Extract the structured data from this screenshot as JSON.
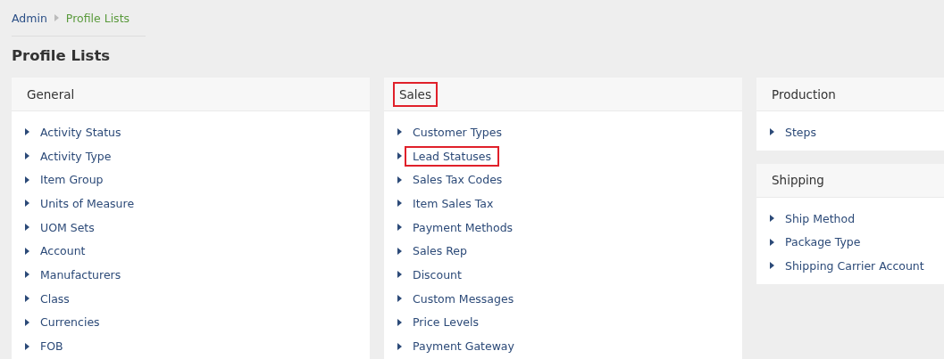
{
  "breadcrumb": [
    {
      "label": "Admin",
      "current": false
    },
    {
      "label": "Profile Lists",
      "current": true
    }
  ],
  "title": "Profile Lists",
  "columns": [
    {
      "panels": [
        {
          "title": "General",
          "highlighted": false,
          "items": [
            {
              "label": "Activity Status",
              "highlighted": false
            },
            {
              "label": "Activity Type",
              "highlighted": false
            },
            {
              "label": "Item Group",
              "highlighted": false
            },
            {
              "label": "Units of Measure",
              "highlighted": false
            },
            {
              "label": "UOM Sets",
              "highlighted": false
            },
            {
              "label": "Account",
              "highlighted": false
            },
            {
              "label": "Manufacturers",
              "highlighted": false
            },
            {
              "label": "Class",
              "highlighted": false
            },
            {
              "label": "Currencies",
              "highlighted": false
            },
            {
              "label": "FOB",
              "highlighted": false
            }
          ]
        }
      ]
    },
    {
      "panels": [
        {
          "title": "Sales",
          "highlighted": true,
          "items": [
            {
              "label": "Customer Types",
              "highlighted": false
            },
            {
              "label": "Lead Statuses",
              "highlighted": true
            },
            {
              "label": "Sales Tax Codes",
              "highlighted": false
            },
            {
              "label": "Item Sales Tax",
              "highlighted": false
            },
            {
              "label": "Payment Methods",
              "highlighted": false
            },
            {
              "label": "Sales Rep",
              "highlighted": false
            },
            {
              "label": "Discount",
              "highlighted": false
            },
            {
              "label": "Custom Messages",
              "highlighted": false
            },
            {
              "label": "Price Levels",
              "highlighted": false
            },
            {
              "label": "Payment Gateway",
              "highlighted": false
            }
          ]
        }
      ]
    },
    {
      "panels": [
        {
          "title": "Production",
          "highlighted": false,
          "items": [
            {
              "label": "Steps",
              "highlighted": false
            }
          ]
        },
        {
          "title": "Shipping",
          "highlighted": false,
          "items": [
            {
              "label": "Ship Method",
              "highlighted": false
            },
            {
              "label": "Package Type",
              "highlighted": false
            },
            {
              "label": "Shipping Carrier Account",
              "highlighted": false
            }
          ]
        }
      ]
    }
  ]
}
